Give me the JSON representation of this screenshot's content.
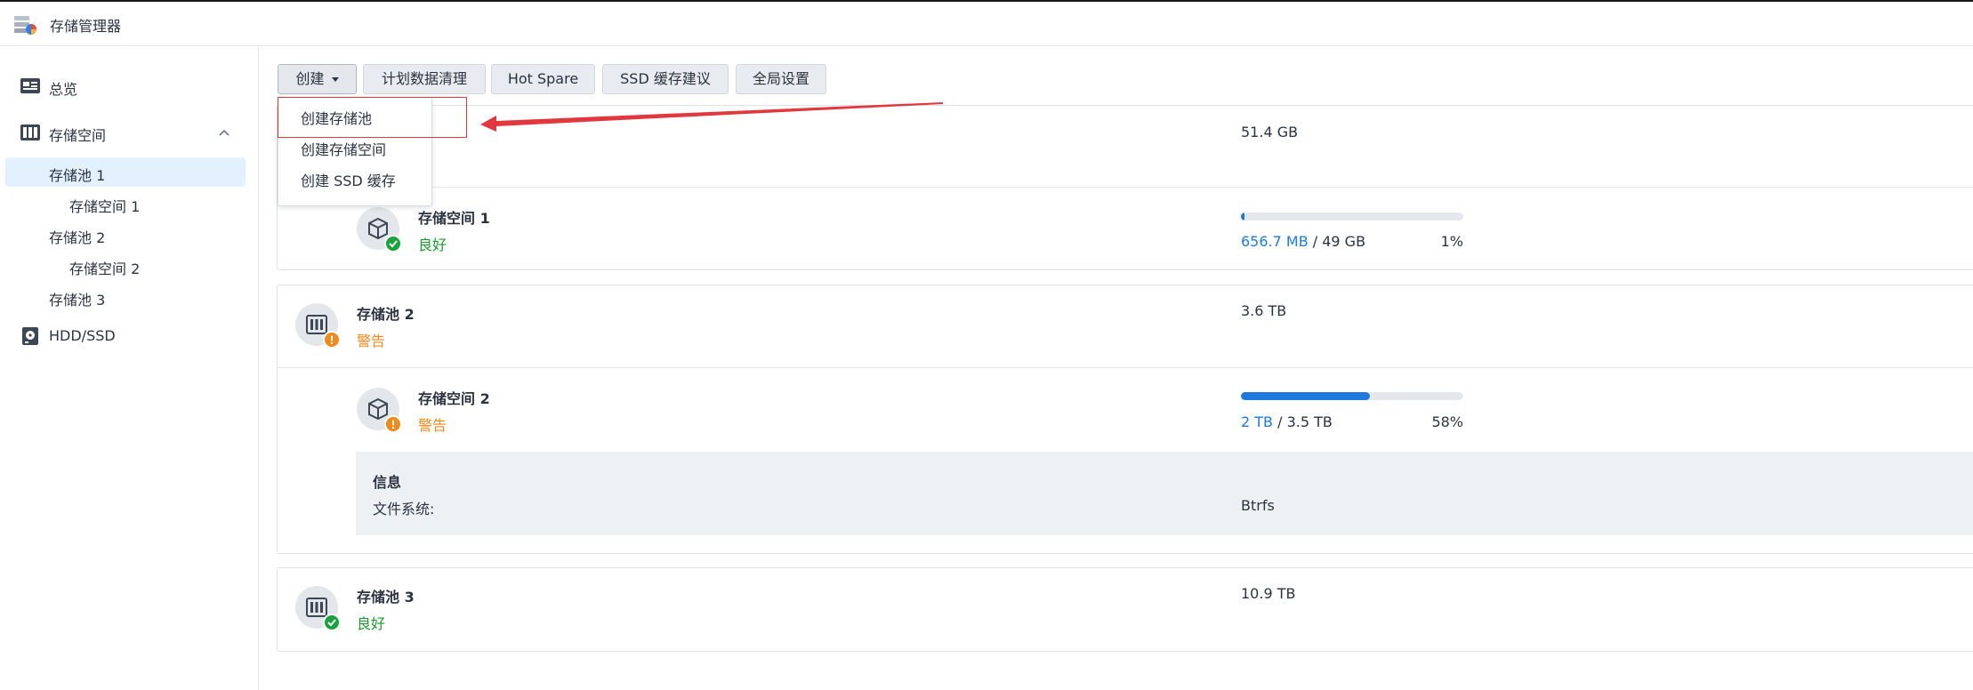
{
  "app": {
    "title": "存储管理器"
  },
  "sidebar": {
    "overview": "总览",
    "storage": "存储空间",
    "items": [
      {
        "label": "存储池 1"
      },
      {
        "label": "存储空间 1"
      },
      {
        "label": "存储池 2"
      },
      {
        "label": "存储空间 2"
      },
      {
        "label": "存储池 3"
      }
    ],
    "hdd": "HDD/SSD"
  },
  "toolbar": {
    "create": "创建",
    "scrub": "计划数据清理",
    "hotspare": "Hot Spare",
    "ssd_advice": "SSD 缓存建议",
    "global": "全局设置"
  },
  "dropdown": {
    "items": [
      "创建存储池",
      "创建存储空间",
      "创建 SSD 缓存"
    ]
  },
  "pool1": {
    "size": "51.4 GB",
    "volume": {
      "name": "存储空间 1",
      "status": "良好",
      "used": "656.7 MB",
      "sep": " / ",
      "total": "49 GB",
      "percent": "1%",
      "fraction": 0.013
    }
  },
  "pool2": {
    "name": "存储池 2",
    "status": "警告",
    "size": "3.6 TB",
    "volume": {
      "name": "存储空间 2",
      "status": "警告",
      "used": "2 TB",
      "sep": " / ",
      "total": "3.5 TB",
      "percent": "58%",
      "fraction": 0.58
    },
    "info": {
      "title": "信息",
      "fs_label": "文件系统:",
      "fs_value": "Btrfs"
    }
  },
  "pool3": {
    "name": "存储池 3",
    "status": "良好",
    "size": "10.9 TB"
  },
  "colors": {
    "accent": "#1f7ae0",
    "ok": "#18a33c",
    "warn": "#f08a1b",
    "annotation": "#e0383e"
  },
  "icons": {
    "app": "storage-manager-icon",
    "overview": "overview-icon",
    "storage": "storage-icon",
    "hdd": "disk-icon",
    "pool": "pool-icon",
    "volume": "volume-cube-icon"
  }
}
